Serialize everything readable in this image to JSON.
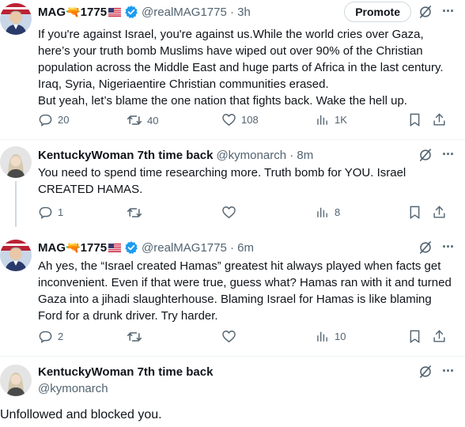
{
  "posts": [
    {
      "name": "MAG🔫1775",
      "handle": "@realMAG1775",
      "time": "· 3h",
      "promote_label": "Promote",
      "text": "If you're against Israel, you're against us.While the world cries over Gaza, here’s your truth bomb Muslims have wiped out over 90% of the Christian population across the Middle East and huge parts of Africa in the last century. Iraq, Syria, Nigeriaentire Christian communities erased.\nBut yeah, let’s blame the one nation that fights back. Wake the hell up.",
      "replies": "20",
      "reposts": "40",
      "likes": "108",
      "views": "1K"
    },
    {
      "name": "KentuckyWoman 7th time back",
      "handle": "@kymonarch",
      "time": "· 8m",
      "text": "You need to spend time researching more. Truth bomb for YOU. Israel CREATED HAMAS.",
      "replies": "1",
      "reposts": "",
      "likes": "",
      "views": "8"
    },
    {
      "name": "MAG🔫1775",
      "handle": "@realMAG1775",
      "time": "· 6m",
      "text": "Ah yes, the “Israel created Hamas” greatest hit always played when facts get inconvenient. Even if that were true, guess what? Hamas ran with it and turned Gaza into a jihadi slaughterhouse. Blaming Israel for Hamas is like blaming Ford for a drunk driver. Try harder.",
      "replies": "2",
      "reposts": "",
      "likes": "",
      "views": "10"
    },
    {
      "name": "KentuckyWoman 7th time back",
      "handle": "@kymonarch"
    }
  ],
  "footer_text": "Unfollowed and blocked you.",
  "icons": {
    "reply": "reply-icon",
    "repost": "repost-icon",
    "like": "heart-icon",
    "views": "views-icon",
    "bookmark": "bookmark-icon",
    "share": "share-icon",
    "grok": "grok-icon",
    "more": "more-icon",
    "verified": "verified-badge-icon"
  },
  "colors": {
    "text": "#0f1419",
    "secondary": "#536471",
    "verified": "#1d9bf0",
    "divider": "#eff3f4"
  }
}
